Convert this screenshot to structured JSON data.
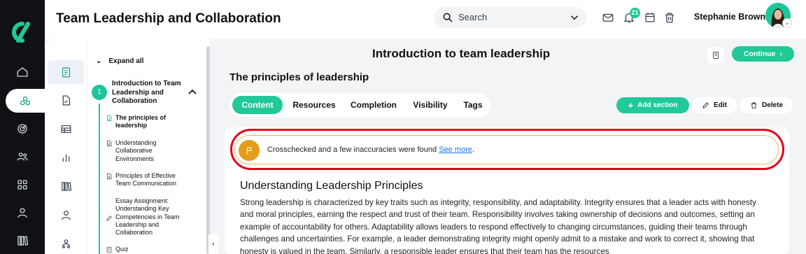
{
  "header": {
    "title": "Team Leadership and Collaboration",
    "search_placeholder": "Search",
    "notification_count": "21",
    "user_name": "Stephanie Brown"
  },
  "rail": {
    "items": [
      "home-icon",
      "modules-icon",
      "target-icon",
      "team-icon",
      "grid-icon",
      "profile-icon",
      "library-icon"
    ]
  },
  "outline": {
    "expand_label": "Expand all",
    "module": {
      "number": "1",
      "title": "Introduction to Team Leadership and Collaboration"
    },
    "items": [
      {
        "label": "The principles of leadership",
        "active": true
      },
      {
        "label": "Understanding Collaborative Environments"
      },
      {
        "label": "Principles of Effective Team Communication"
      },
      {
        "label": "Essay Assignment: Understanding Key Competencies in Team Leadership and Collaboration"
      },
      {
        "label": "Quiz"
      }
    ]
  },
  "main": {
    "title": "Introduction to team leadership",
    "continue_label": "Continue",
    "subtitle": "The principles of leadership",
    "tabs": [
      "Content",
      "Resources",
      "Completion",
      "Visibility",
      "Tags"
    ],
    "add_section_label": "Add section",
    "edit_label": "Edit",
    "delete_label": "Delete",
    "alert_text": "Crosschecked and a few inaccuracies were found",
    "alert_link": "See more",
    "section_heading": "Understanding Leadership Principles",
    "body": "Strong leadership is characterized by key traits such as integrity, responsibility, and adaptability. Integrity ensures that a leader acts with honesty and moral principles, earning the respect and trust of their team. Responsibility involves taking ownership of decisions and outcomes, setting an example of accountability for others. Adaptability allows leaders to respond effectively to changing circumstances, guiding their teams through challenges and uncertainties. For example, a leader demonstrating integrity might openly admit to a mistake and work to correct it, showing that honesty is valued in the team. Similarly, a responsible leader ensures that their team has the resources"
  },
  "colors": {
    "accent": "#20c997",
    "rail_bg": "#0f1115",
    "alert_ring": "#e3001b",
    "alert_icon": "#e59c1a",
    "link": "#1a73e8"
  }
}
